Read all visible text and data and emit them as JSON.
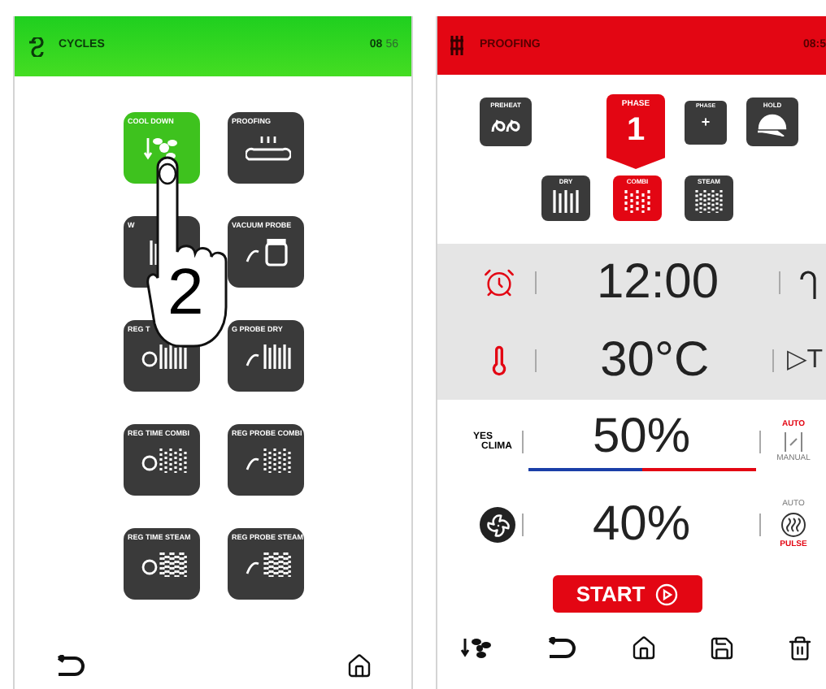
{
  "cycles_screen": {
    "header": {
      "title": "CYCLES",
      "time_hours": "08",
      "time_minutes": "56"
    },
    "tiles": [
      {
        "label": "COOL DOWN",
        "kind": "cool",
        "selected": true
      },
      {
        "label": "PROOFING",
        "kind": "bread",
        "selected": false
      },
      {
        "label": "W",
        "kind": "bars",
        "selected": false
      },
      {
        "label": "VACUUM PROBE",
        "kind": "jar",
        "selected": false
      },
      {
        "label": "REG T",
        "kind": "timer-bars",
        "selected": false
      },
      {
        "label": "G PROBE DRY",
        "kind": "probe-bars",
        "selected": false
      },
      {
        "label": "REG TIME COMBI",
        "kind": "timer-combi",
        "selected": false
      },
      {
        "label": "REG PROBE COMBI",
        "kind": "probe-combi",
        "selected": false
      },
      {
        "label": "REG TIME STEAM",
        "kind": "timer-steam",
        "selected": false
      },
      {
        "label": "REG PROBE STEAM",
        "kind": "probe-steam",
        "selected": false
      }
    ],
    "hand": {
      "label": "2"
    }
  },
  "proofing_screen": {
    "header": {
      "title": "PROOFING",
      "time": "08:5"
    },
    "top_tiles": [
      {
        "label": "PREHEAT",
        "kind": "preheat",
        "selected": false
      },
      {
        "label": "PHASE",
        "value": "1",
        "kind": "phase",
        "selected": true
      },
      {
        "label": "PHASE",
        "value": "+",
        "kind": "add",
        "selected": false
      },
      {
        "label": "HOLD",
        "kind": "hold",
        "selected": false
      }
    ],
    "modes": [
      {
        "label": "DRY",
        "kind": "dry",
        "selected": false
      },
      {
        "label": "COMBI",
        "kind": "combi",
        "selected": true
      },
      {
        "label": "STEAM",
        "kind": "steam",
        "selected": false
      }
    ],
    "time": {
      "value": "12:00"
    },
    "temperature": {
      "value": "30°C",
      "delta": "▷T"
    },
    "humidity": {
      "logo_top": "YES",
      "logo_bottom": "CLIMA",
      "value": "50%",
      "level": 0.5,
      "options": [
        {
          "label": "AUTO",
          "selected": true
        },
        {
          "label": "MANUAL",
          "selected": false
        }
      ]
    },
    "fan": {
      "value": "40%",
      "options": [
        {
          "label": "AUTO",
          "selected": false
        },
        {
          "label": "PULSE",
          "selected": true
        }
      ]
    },
    "start": {
      "label": "START"
    }
  }
}
